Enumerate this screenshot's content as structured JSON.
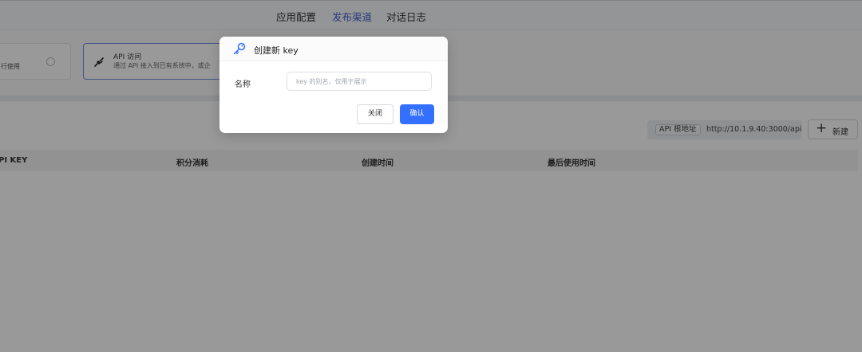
{
  "nav": {
    "tabs": [
      {
        "label": "应用配置",
        "active": false
      },
      {
        "label": "发布渠道",
        "active": true
      },
      {
        "label": "对话日志",
        "active": false
      }
    ]
  },
  "channels": {
    "card1": {
      "desc": "行使用"
    },
    "card2": {
      "title": "API 访问",
      "desc": "通过 API 接入到已有系统中，或企",
      "icon": "api-plug-icon",
      "selected": true
    }
  },
  "toolbar": {
    "api_base_label": "API 根地址",
    "api_base_value": "http://10.1.9.40:3000/api",
    "new_button": "新建"
  },
  "table": {
    "columns": [
      "PI KEY",
      "积分消耗",
      "创建时间",
      "最后使用时间"
    ]
  },
  "modal": {
    "title": "创建新 key",
    "icon": "key-icon",
    "name_label": "名称",
    "name_placeholder": "key 的别名，仅用于展示",
    "name_value": "",
    "close_button": "关闭",
    "confirm_button": "确认"
  },
  "colors": {
    "accent": "#3370ff",
    "active_tab": "#4262cf",
    "overlay": "rgba(0,0,0,0.4)"
  }
}
